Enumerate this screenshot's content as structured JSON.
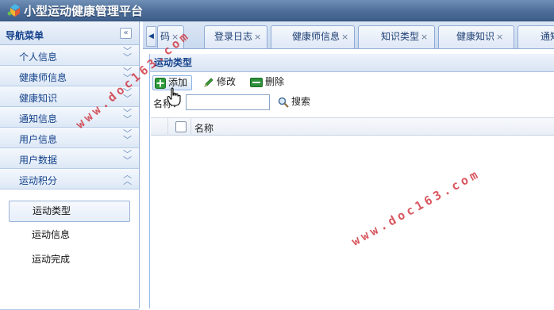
{
  "app": {
    "title": "小型运动健康管理平台"
  },
  "sidebar": {
    "title": "导航菜单",
    "collapse_icon": "double-chevron-left-icon",
    "items": [
      {
        "label": "个人信息",
        "expanded": false
      },
      {
        "label": "健康师信息",
        "expanded": false
      },
      {
        "label": "健康知识",
        "expanded": false
      },
      {
        "label": "通知信息",
        "expanded": false
      },
      {
        "label": "用户信息",
        "expanded": false
      },
      {
        "label": "用户数据",
        "expanded": false
      },
      {
        "label": "运动积分",
        "expanded": true
      }
    ],
    "sub_items": [
      {
        "label": "运动类型",
        "active": true
      },
      {
        "label": "运动信息",
        "active": false
      },
      {
        "label": "运动完成",
        "active": false
      }
    ]
  },
  "tabs": [
    {
      "label": "码",
      "close": "×"
    },
    {
      "label": "登录日志",
      "close": "×"
    },
    {
      "label": "健康师信息",
      "close": "×"
    },
    {
      "label": "知识类型",
      "close": "×"
    },
    {
      "label": "健康知识",
      "close": "×"
    },
    {
      "label": "通知",
      "close": ""
    }
  ],
  "panel": {
    "title": "运动类型",
    "toolbar": {
      "add_label": "添加",
      "edit_label": "修改",
      "delete_label": "删除"
    },
    "search": {
      "label": "名称：",
      "value": "",
      "placeholder": "",
      "button_label": "搜索"
    },
    "grid": {
      "columns": [
        "名称"
      ],
      "rows": []
    }
  },
  "watermarks": [
    "www.doc163.com",
    "www.doc163.com"
  ],
  "colors": {
    "header": "#4d6e98",
    "accent": "#15428b",
    "watermark": "#cd2832"
  }
}
